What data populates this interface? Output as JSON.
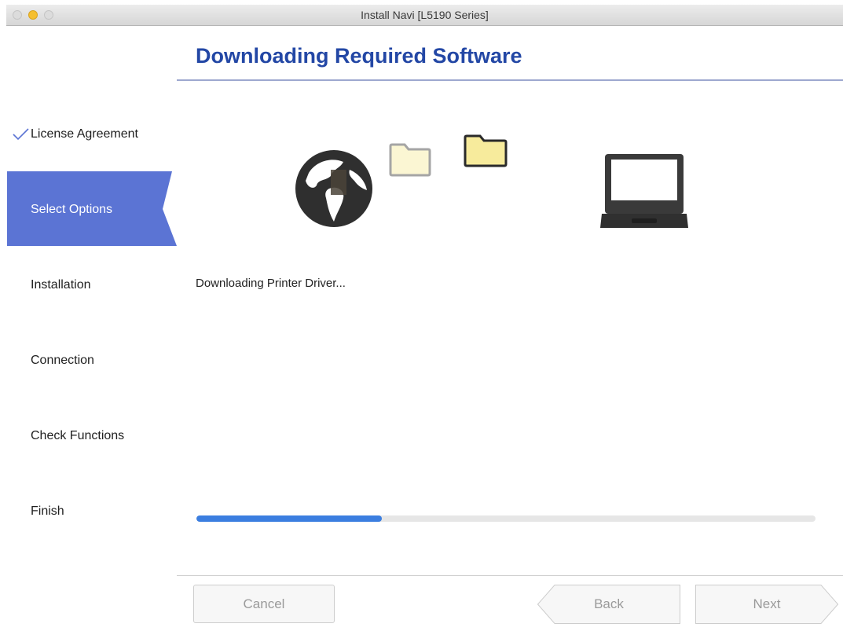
{
  "window": {
    "title": "Install Navi [L5190 Series]"
  },
  "page_title": "Downloading Required Software",
  "steps": [
    {
      "label": "License Agreement",
      "state": "done"
    },
    {
      "label": "Select Options",
      "state": "current"
    },
    {
      "label": "Installation",
      "state": "pending"
    },
    {
      "label": "Connection",
      "state": "pending"
    },
    {
      "label": "Check Functions",
      "state": "pending"
    },
    {
      "label": "Finish",
      "state": "pending"
    }
  ],
  "illustration": {
    "icons": [
      "globe-icon",
      "folder-icon",
      "folder-icon",
      "laptop-icon"
    ]
  },
  "status": {
    "text": "Downloading Printer Driver...",
    "progress_fraction": 0.3
  },
  "buttons": {
    "cancel": "Cancel",
    "back": "Back",
    "next": "Next"
  },
  "colors": {
    "accent": "#2347a5",
    "sidebar_active": "#5b74d4",
    "progress": "#3b7ee0",
    "window_minimize": "#f5bf2f"
  }
}
